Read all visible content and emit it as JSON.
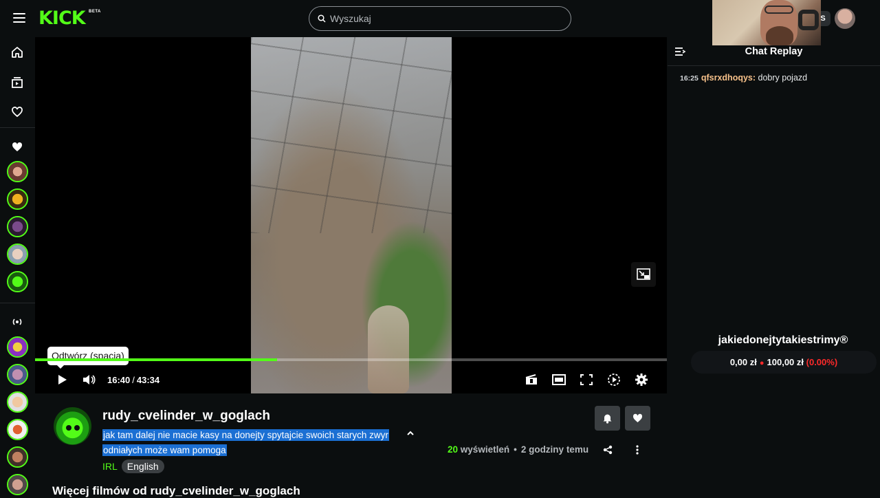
{
  "header": {
    "logo": "KICK",
    "logo_badge": "BETA",
    "search_placeholder": "Wyszukaj",
    "user_badge": "S"
  },
  "player": {
    "tooltip": "Odtwórz (spacja)",
    "current_time": "16:40",
    "duration": "43:34",
    "progress_percent": 38.3
  },
  "chat": {
    "title": "Chat Replay",
    "messages": [
      {
        "time": "16:25",
        "user": "qfsrxdhoqys",
        "text": "dobry pojazd"
      }
    ],
    "goal": {
      "title": "jakiedonejtytakiestrimy®",
      "current": "0,00 zł",
      "target": "100,00 zł",
      "percent": "(0.00%)"
    }
  },
  "video_info": {
    "streamer": "rudy_cvelinder_w_goglach",
    "title_line1": "jak tam dalej nie macie kasy na donejty spytajcie swoich starych zwyr",
    "title_line2": "odniałych może wam pomoga",
    "category": "IRL",
    "language": "English",
    "views_count": "20",
    "views_label": "wyświetleń",
    "time_ago": "2 godziny temu",
    "more_videos": "Więcej filmów od rudy_cvelinder_w_goglach"
  },
  "colors": {
    "accent": "#53fc18",
    "background": "#0b0e0f",
    "selection": "#1b6fd3",
    "goal_red": "#ff2a2a",
    "chat_username": "#f7c18a"
  }
}
